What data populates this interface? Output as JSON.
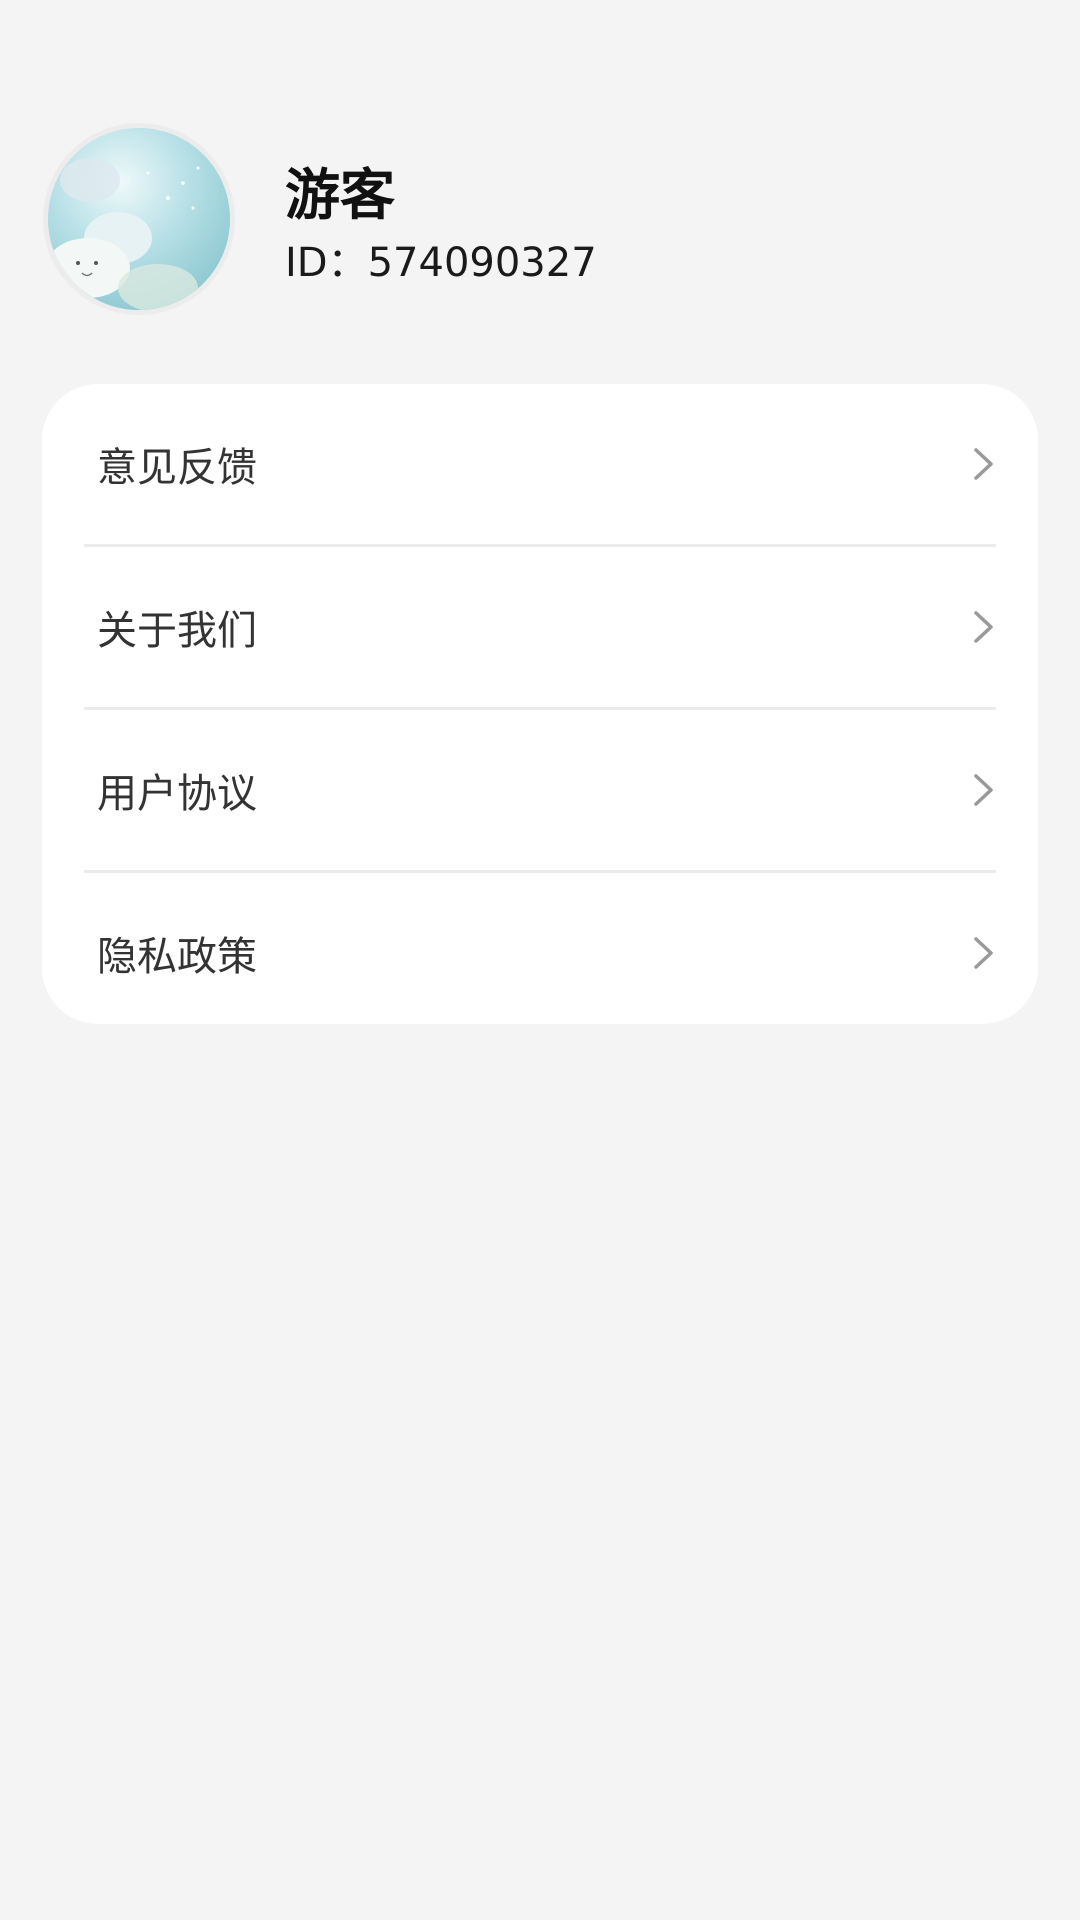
{
  "profile": {
    "name": "游客",
    "id_text": "ID：574090327"
  },
  "menu": {
    "items": [
      {
        "label": "意见反馈",
        "icon": "chevron-right-icon"
      },
      {
        "label": "关于我们",
        "icon": "chevron-right-icon"
      },
      {
        "label": "用户协议",
        "icon": "chevron-right-icon"
      },
      {
        "label": "隐私政策",
        "icon": "chevron-right-icon"
      }
    ]
  },
  "colors": {
    "page_background": "#f4f4f4",
    "card_background": "#ffffff",
    "divider": "#ebebeb",
    "chevron": "#999999",
    "menu_text": "#333333",
    "name_text": "#111111"
  }
}
